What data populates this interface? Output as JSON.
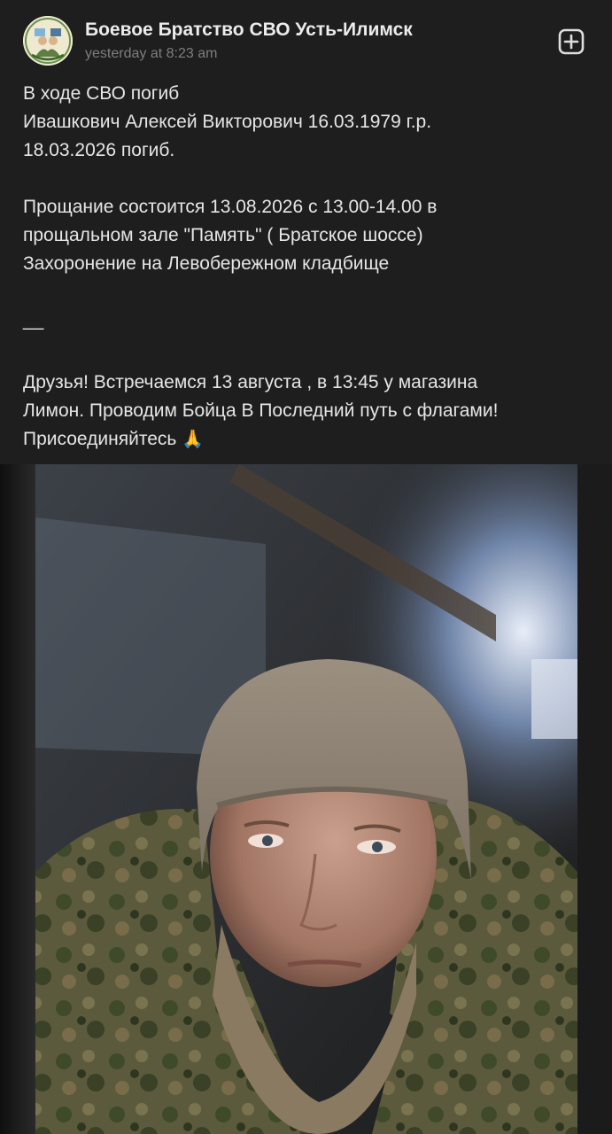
{
  "post": {
    "group_name": "Боевое Братство СВО Усть-Илимск",
    "time": "yesterday at 8:23 am",
    "lines": [
      "В ходе СВО погиб",
      "Ивашкович Алексей Викторович 16.03.1979 г.р.",
      "18.03.2026 погиб.",
      "Прощание состоится 13.08.2026 с 13.00-14.00 в",
      "прощальном зале \"Память\" ( Братское шоссе)",
      "Захоронение на Левобережном кладбище",
      "__",
      "Друзья! Встречаемся 13 августа , в 13:45 у магазина",
      "Лимон. Проводим Бойца В Последний путь с флагами!",
      "Присоединяйтесь"
    ],
    "emoji": "🙏"
  },
  "icons": {
    "avatar": "group-logo-icon",
    "add": "add-square-icon"
  },
  "colors": {
    "background": "#1e1e1e",
    "text": "#e6e6e6",
    "muted": "#7e7e7e"
  }
}
